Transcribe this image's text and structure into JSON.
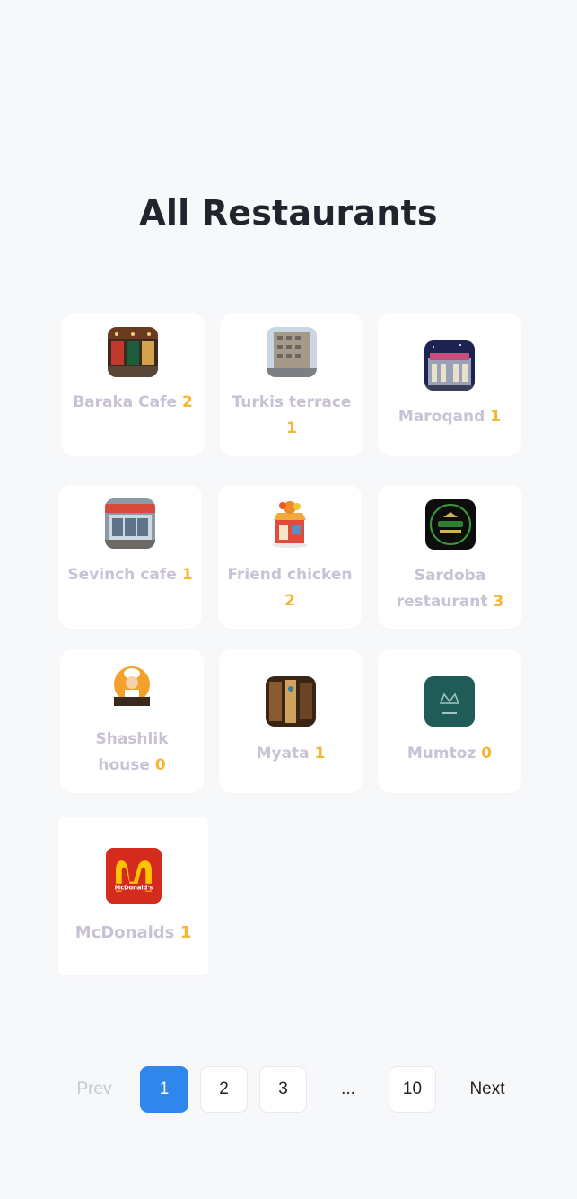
{
  "page": {
    "title": "All Restaurants"
  },
  "restaurants": [
    {
      "name": "Baraka Cafe",
      "count": "2",
      "icon": "restaurant-photo-icon"
    },
    {
      "name": "Turkis terrace",
      "count": "1",
      "icon": "building-photo-icon"
    },
    {
      "name": "Maroqand",
      "count": "1",
      "icon": "palace-photo-icon"
    },
    {
      "name": "Sevinch cafe",
      "count": "1",
      "icon": "storefront-photo-icon"
    },
    {
      "name": "Friend chicken",
      "count": "2",
      "icon": "chicken-shop-icon"
    },
    {
      "name": "Sardoba restaurant",
      "count": "3",
      "icon": "sardoba-logo-icon"
    },
    {
      "name": "Shashlik house",
      "count": "0",
      "icon": "chef-logo-icon"
    },
    {
      "name": "Myata",
      "count": "1",
      "icon": "interior-photo-icon"
    },
    {
      "name": "Mumtoz",
      "count": "0",
      "icon": "crown-logo-icon"
    },
    {
      "name": "McDonalds",
      "count": "1",
      "icon": "mcdonalds-logo-icon"
    }
  ],
  "pagination": {
    "prev": "Prev",
    "pages": [
      "1",
      "2",
      "3"
    ],
    "ellipsis": "...",
    "last": "10",
    "next": "Next",
    "current": "1"
  },
  "colors": {
    "background": "#f7f8fa",
    "accent": "#2f86eb",
    "count": "#f5b731",
    "name": "#c9c2d4"
  }
}
